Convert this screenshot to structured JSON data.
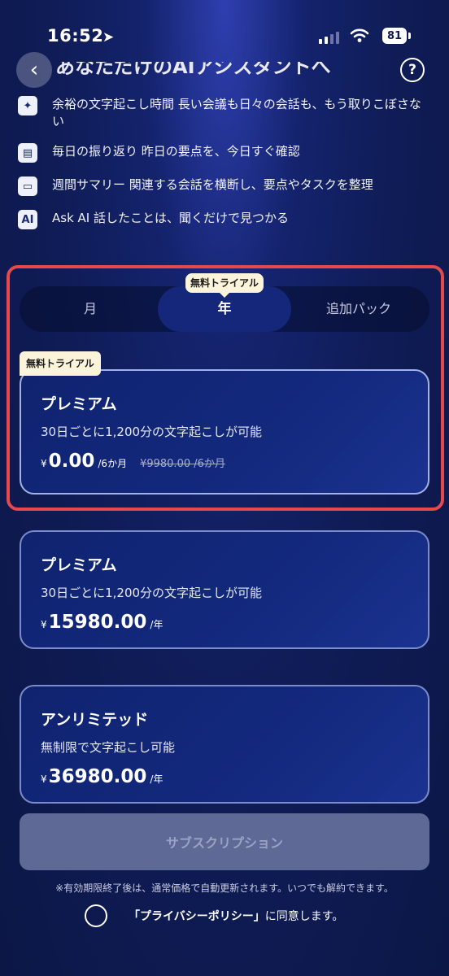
{
  "status_bar": {
    "time": "16:52",
    "battery": "81"
  },
  "header": {
    "title": "あなただけのAIアシスタントへ",
    "help": "?"
  },
  "features": [
    {
      "icon": "sparkle-icon",
      "glyph": "✦",
      "text": "余裕の文字起こし時間 長い会議も日々の会話も、もう取りこぼさない"
    },
    {
      "icon": "calendar-icon",
      "glyph": "▤",
      "text": "毎日の振り返り 昨日の要点を、今日すぐ確認"
    },
    {
      "icon": "chat-icon",
      "glyph": "▭",
      "text": "週間サマリー 関連する会話を横断し、要点やタスクを整理"
    },
    {
      "icon": "ai-icon",
      "glyph": "AI",
      "text": "Ask AI 話したことは、聞くだけで見つかる"
    }
  ],
  "tabs": {
    "month": "月",
    "year": "年",
    "addon": "追加パック",
    "trial_badge": "無料トライアル",
    "selected": "年"
  },
  "plans": [
    {
      "tag": "無料トライアル",
      "name": "プレミアム",
      "desc": "30日ごとに1,200分の文字起こしが可能",
      "currency": "¥",
      "amount": "0.00",
      "period": "/6か月",
      "original": "¥9980.00 /6か月",
      "selected": true
    },
    {
      "name": "プレミアム",
      "desc": "30日ごとに1,200分の文字起こしが可能",
      "currency": "¥",
      "amount": "15980.00",
      "period": "/年"
    },
    {
      "name": "アンリミテッド",
      "desc": "無制限で文字起こし可能",
      "currency": "¥",
      "amount": "36980.00",
      "period": "/年"
    }
  ],
  "subscribe_label": "サブスクリプション",
  "note": "※有効期限終了後は、通常価格で自動更新されます。いつでも解約できます。",
  "agree": {
    "policy": "「プライバシーポリシー」",
    "suffix": "に同意します。"
  },
  "colors": {
    "background": "#0f1c56",
    "highlight_border": "#e5484d",
    "badge": "#fbf3da",
    "button_disabled": "#5e6a95"
  }
}
